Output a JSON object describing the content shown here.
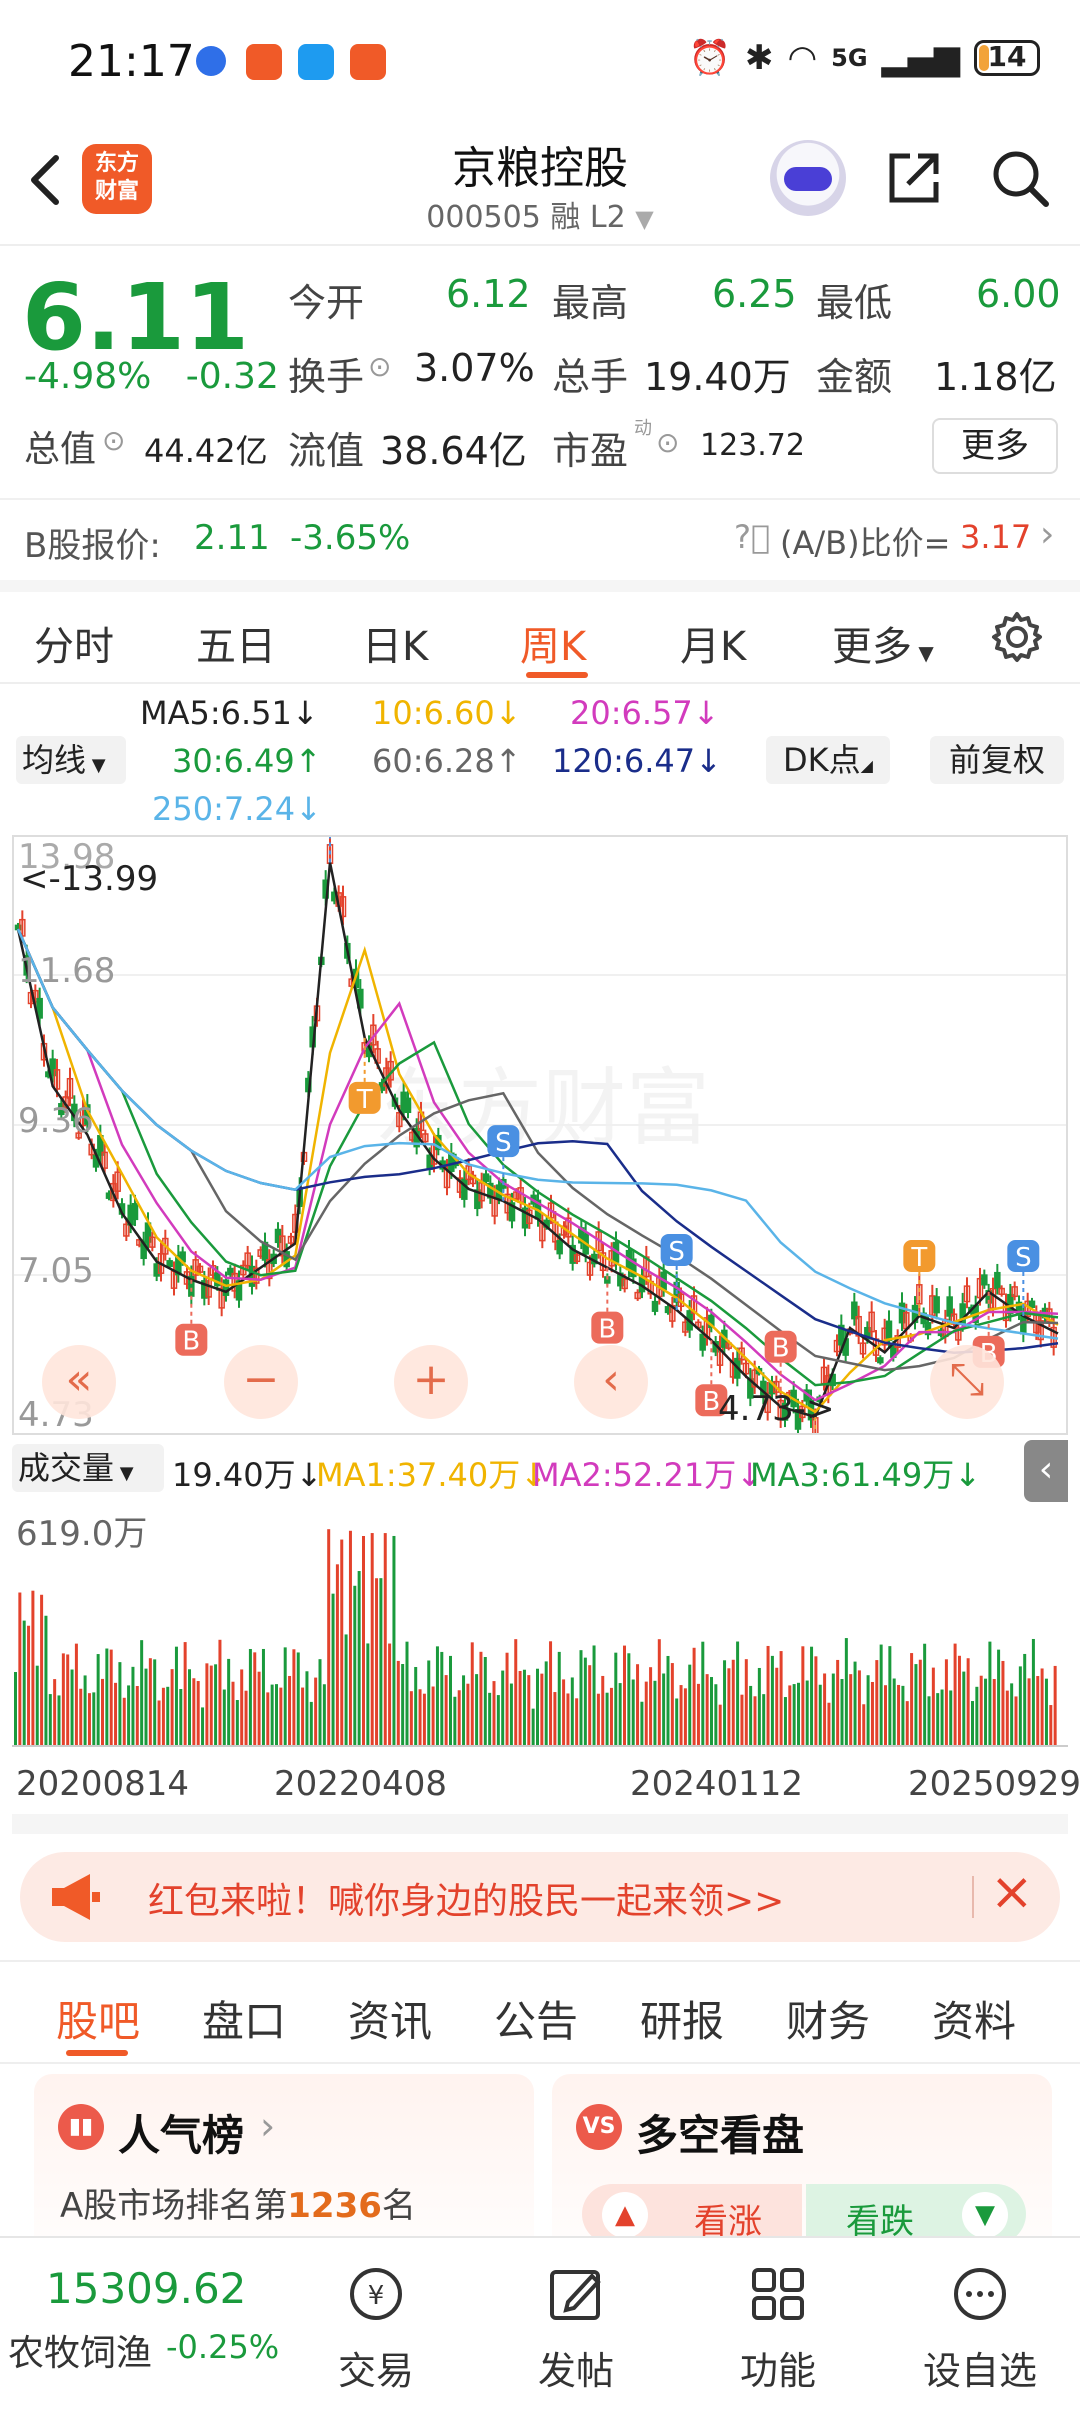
{
  "status": {
    "time": "21:17",
    "battery": "14",
    "network": "5G"
  },
  "header": {
    "logo_line1": "东方",
    "logo_line2": "财富",
    "name": "京粮控股",
    "code_line": "000505 融 L2"
  },
  "quote": {
    "price": "6.11",
    "change_pct": "-4.98%",
    "change_abs": "-0.32",
    "open_label": "今开",
    "open": "6.12",
    "high_label": "最高",
    "high": "6.25",
    "low_label": "最低",
    "low": "6.00",
    "turnover_label": "换手",
    "turnover": "3.07%",
    "volume_label": "总手",
    "volume": "19.40万",
    "amount_label": "金额",
    "amount": "1.18亿",
    "mktcap_label": "总值",
    "mktcap": "44.42亿",
    "float_label": "流值",
    "float": "38.64亿",
    "pe_label": "市盈",
    "pe_sup": "动",
    "pe": "123.72",
    "more": "更多",
    "bshare_label": "B股报价:",
    "bshare_price": "2.11",
    "bshare_pct": "-3.65%",
    "ab_ratio_label": "(A/B)比价=",
    "ab_ratio": "3.17"
  },
  "chart_tabs": [
    "分时",
    "五日",
    "日K",
    "周K",
    "月K",
    "更多"
  ],
  "ma": {
    "select": "均线",
    "ma5": "MA5:6.51",
    "ma10": "10:6.60",
    "ma20": "20:6.57",
    "ma30": "30:6.49",
    "ma60": "60:6.28",
    "ma120": "120:6.47",
    "ma250": "250:7.24",
    "dk": "DK点",
    "adjust": "前复权",
    "colors": {
      "ma5": "#222222",
      "ma10": "#f0b400",
      "ma20": "#d23bbd",
      "ma30": "#1a9a3c",
      "ma60": "#666666",
      "ma120": "#1a2d8a",
      "ma250": "#5ab4e8"
    }
  },
  "chart": {
    "y_max": "13.98",
    "max_marker": "<-13.99",
    "y_mid1": "11.68",
    "y_mid2": "9.36",
    "y_mid3": "7.05",
    "y_min": "4.73",
    "min_marker": "4.73->",
    "watermark": "东方财富",
    "vol_label": "成交量",
    "vol_value": "19.40万",
    "vol_ma1": "MA1:37.40万",
    "vol_ma2": "MA2:52.21万",
    "vol_ma3": "MA3:61.49万",
    "vol_max": "619.0万",
    "dates": [
      "20200814",
      "20220408",
      "20240112",
      "20250929"
    ]
  },
  "chart_data": {
    "type": "line",
    "title": "",
    "ylim": [
      4.73,
      13.99
    ],
    "x": [
      "20200814",
      "20220408",
      "20240112",
      "20250929"
    ],
    "series": [
      {
        "name": "MA5",
        "last": 6.51
      },
      {
        "name": "10",
        "last": 6.6
      },
      {
        "name": "20",
        "last": 6.57
      },
      {
        "name": "30",
        "last": 6.49
      },
      {
        "name": "60",
        "last": 6.28
      },
      {
        "name": "120",
        "last": 6.47
      },
      {
        "name": "250",
        "last": 7.24
      }
    ],
    "price_path": [
      12.8,
      10.2,
      9.4,
      8.1,
      7.3,
      7.0,
      6.8,
      7.2,
      7.6,
      13.9,
      11.0,
      9.8,
      9.0,
      8.5,
      8.3,
      8.0,
      7.5,
      7.2,
      6.9,
      6.5,
      6.0,
      5.4,
      4.9,
      4.73,
      6.2,
      5.8,
      6.4,
      6.2,
      6.8,
      6.4,
      6.11
    ]
  },
  "banner": {
    "text": "红包来啦！喊你身边的股民一起来领>>"
  },
  "bottom_tabs": [
    "股吧",
    "盘口",
    "资讯",
    "公告",
    "研报",
    "财务",
    "资料"
  ],
  "cards": {
    "popular_title": "人气榜",
    "popular_desc_pre": "A股市场排名第",
    "popular_rank": "1236",
    "popular_desc_post": "名",
    "bullbear_title": "多空看盘",
    "bull": "看涨",
    "bear": "看跌"
  },
  "bottom_nav": {
    "index_value": "15309.62",
    "index_name": "农牧饲渔",
    "index_pct": "-0.25%",
    "trade": "交易",
    "post": "发帖",
    "features": "功能",
    "watchlist": "设自选"
  }
}
